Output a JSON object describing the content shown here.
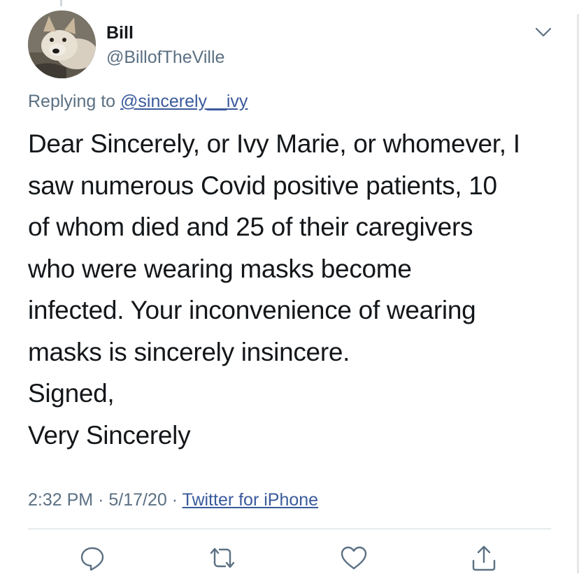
{
  "tweet": {
    "display_name": "Bill",
    "handle": "@BillofTheVille",
    "replying_prefix": "Replying to",
    "replying_to": "@sincerely__ivy",
    "body_lines": [
      "Dear Sincerely, or Ivy Marie, or whomever, I",
      "saw numerous Covid positive patients, 10",
      "of whom died and 25 of their caregivers",
      "who were wearing masks become",
      "infected. Your inconvenience of wearing",
      "masks is sincerely insincere.",
      "Signed,",
      "Very Sincerely"
    ],
    "time": "2:32 PM",
    "date": "5/17/20",
    "separator": "·",
    "source": "Twitter for iPhone"
  },
  "icons": {
    "more": "chevron-down-icon",
    "reply": "reply-icon",
    "retweet": "retweet-icon",
    "like": "heart-icon",
    "share": "share-icon"
  },
  "colors": {
    "text": "#14171a",
    "secondary": "#5b7083",
    "link": "#3a5a9c",
    "divider": "#cfd9de"
  }
}
